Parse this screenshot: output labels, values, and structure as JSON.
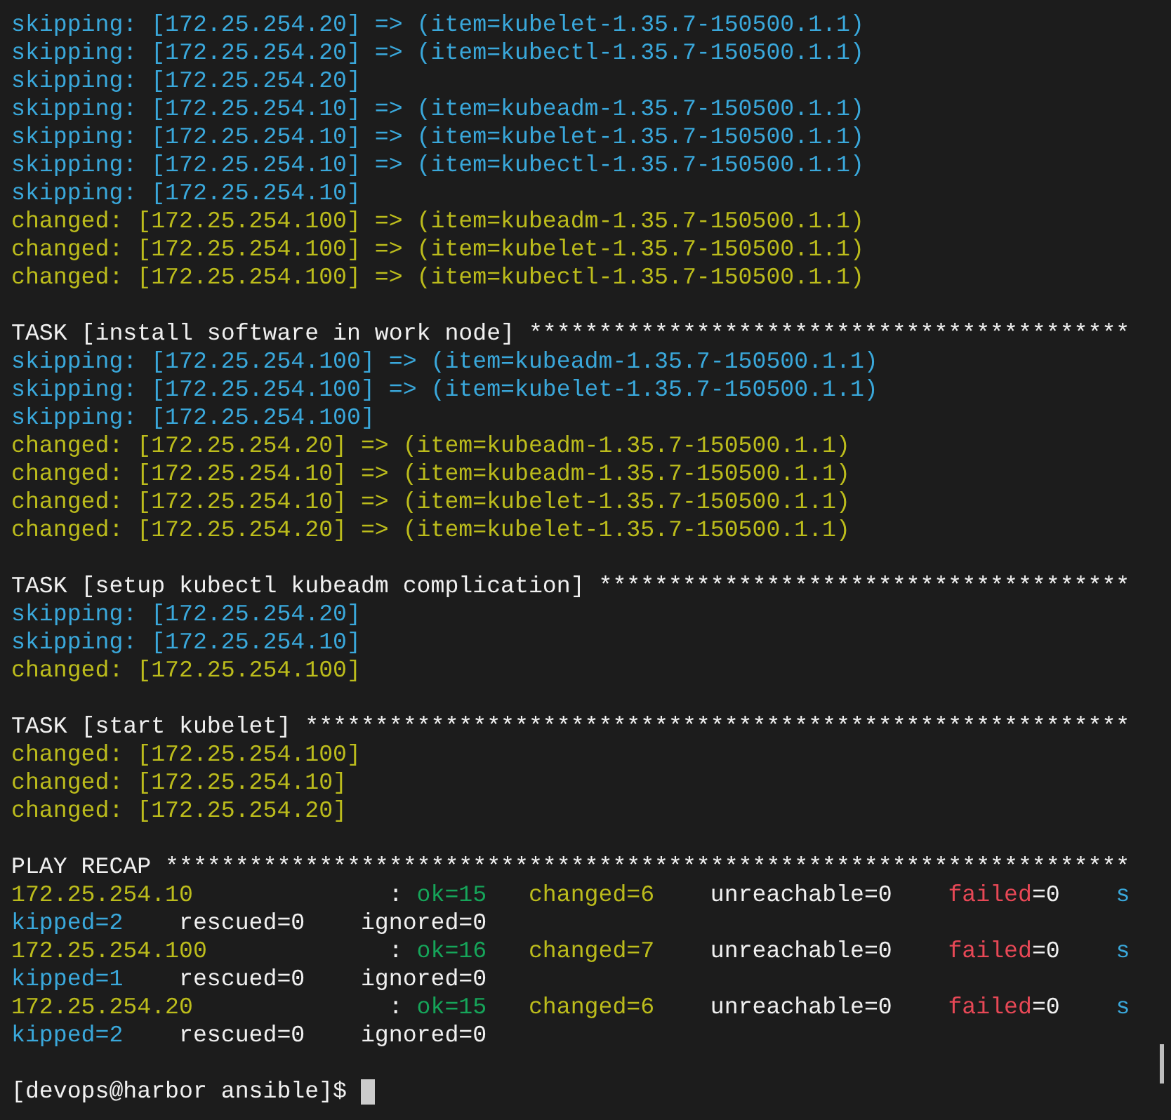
{
  "terminal": {
    "lines": [
      {
        "kind": "text",
        "segments": [
          {
            "text": "skipping: [172.25.254.20] => (item=kubelet-1.35.7-150500.1.1)",
            "color": "#3aa8db"
          }
        ]
      },
      {
        "kind": "text",
        "segments": [
          {
            "text": "skipping: [172.25.254.20] => (item=kubectl-1.35.7-150500.1.1)",
            "color": "#3aa8db"
          }
        ]
      },
      {
        "kind": "text",
        "segments": [
          {
            "text": "skipping: [172.25.254.20]",
            "color": "#3aa8db"
          }
        ]
      },
      {
        "kind": "text",
        "segments": [
          {
            "text": "skipping: [172.25.254.10] => (item=kubeadm-1.35.7-150500.1.1)",
            "color": "#3aa8db"
          }
        ]
      },
      {
        "kind": "text",
        "segments": [
          {
            "text": "skipping: [172.25.254.10] => (item=kubelet-1.35.7-150500.1.1)",
            "color": "#3aa8db"
          }
        ]
      },
      {
        "kind": "text",
        "segments": [
          {
            "text": "skipping: [172.25.254.10] => (item=kubectl-1.35.7-150500.1.1)",
            "color": "#3aa8db"
          }
        ]
      },
      {
        "kind": "text",
        "segments": [
          {
            "text": "skipping: [172.25.254.10]",
            "color": "#3aa8db"
          }
        ]
      },
      {
        "kind": "text",
        "segments": [
          {
            "text": "changed: [172.25.254.100] => (item=kubeadm-1.35.7-150500.1.1)",
            "color": "#bcbc1c"
          }
        ]
      },
      {
        "kind": "text",
        "segments": [
          {
            "text": "changed: [172.25.254.100] => (item=kubelet-1.35.7-150500.1.1)",
            "color": "#bcbc1c"
          }
        ]
      },
      {
        "kind": "text",
        "segments": [
          {
            "text": "changed: [172.25.254.100] => (item=kubectl-1.35.7-150500.1.1)",
            "color": "#bcbc1c"
          }
        ]
      },
      {
        "kind": "blank"
      },
      {
        "kind": "text",
        "segments": [
          {
            "text": "TASK [install software in work node] *******************************************",
            "color": "#f0f0f0"
          }
        ]
      },
      {
        "kind": "text",
        "segments": [
          {
            "text": "skipping: [172.25.254.100] => (item=kubeadm-1.35.7-150500.1.1)",
            "color": "#3aa8db"
          }
        ]
      },
      {
        "kind": "text",
        "segments": [
          {
            "text": "skipping: [172.25.254.100] => (item=kubelet-1.35.7-150500.1.1)",
            "color": "#3aa8db"
          }
        ]
      },
      {
        "kind": "text",
        "segments": [
          {
            "text": "skipping: [172.25.254.100]",
            "color": "#3aa8db"
          }
        ]
      },
      {
        "kind": "text",
        "segments": [
          {
            "text": "changed: [172.25.254.20] => (item=kubeadm-1.35.7-150500.1.1)",
            "color": "#bcbc1c"
          }
        ]
      },
      {
        "kind": "text",
        "segments": [
          {
            "text": "changed: [172.25.254.10] => (item=kubeadm-1.35.7-150500.1.1)",
            "color": "#bcbc1c"
          }
        ]
      },
      {
        "kind": "text",
        "segments": [
          {
            "text": "changed: [172.25.254.10] => (item=kubelet-1.35.7-150500.1.1)",
            "color": "#bcbc1c"
          }
        ]
      },
      {
        "kind": "text",
        "segments": [
          {
            "text": "changed: [172.25.254.20] => (item=kubelet-1.35.7-150500.1.1)",
            "color": "#bcbc1c"
          }
        ]
      },
      {
        "kind": "blank"
      },
      {
        "kind": "text",
        "segments": [
          {
            "text": "TASK [setup kubectl kubeadm complication] **************************************",
            "color": "#f0f0f0"
          }
        ]
      },
      {
        "kind": "text",
        "segments": [
          {
            "text": "skipping: [172.25.254.20]",
            "color": "#3aa8db"
          }
        ]
      },
      {
        "kind": "text",
        "segments": [
          {
            "text": "skipping: [172.25.254.10]",
            "color": "#3aa8db"
          }
        ]
      },
      {
        "kind": "text",
        "segments": [
          {
            "text": "changed: [172.25.254.100]",
            "color": "#bcbc1c"
          }
        ]
      },
      {
        "kind": "blank"
      },
      {
        "kind": "text",
        "segments": [
          {
            "text": "TASK [start kubelet] ***********************************************************",
            "color": "#f0f0f0"
          }
        ]
      },
      {
        "kind": "text",
        "segments": [
          {
            "text": "changed: [172.25.254.100]",
            "color": "#bcbc1c"
          }
        ]
      },
      {
        "kind": "text",
        "segments": [
          {
            "text": "changed: [172.25.254.10]",
            "color": "#bcbc1c"
          }
        ]
      },
      {
        "kind": "text",
        "segments": [
          {
            "text": "changed: [172.25.254.20]",
            "color": "#bcbc1c"
          }
        ]
      },
      {
        "kind": "blank"
      },
      {
        "kind": "text",
        "segments": [
          {
            "text": "PLAY RECAP *********************************************************************",
            "color": "#f0f0f0"
          }
        ]
      },
      {
        "kind": "text",
        "segments": [
          {
            "text": "172.25.254.10",
            "color": "#bcbc1c"
          },
          {
            "text": "              : ",
            "color": "#f0f0f0"
          },
          {
            "text": "ok=15   ",
            "color": "#16a55a"
          },
          {
            "text": "changed=6",
            "color": "#bcbc1c"
          },
          {
            "text": "    unreachable=0    ",
            "color": "#f0f0f0"
          },
          {
            "text": "failed",
            "color": "#e74856"
          },
          {
            "text": "=0    ",
            "color": "#f0f0f0"
          },
          {
            "text": "s",
            "color": "#3aa8db"
          }
        ]
      },
      {
        "kind": "text",
        "segments": [
          {
            "text": "kipped=2",
            "color": "#3aa8db"
          },
          {
            "text": "    rescued=0    ignored=0",
            "color": "#f0f0f0"
          }
        ]
      },
      {
        "kind": "text",
        "segments": [
          {
            "text": "172.25.254.100",
            "color": "#bcbc1c"
          },
          {
            "text": "             : ",
            "color": "#f0f0f0"
          },
          {
            "text": "ok=16   ",
            "color": "#16a55a"
          },
          {
            "text": "changed=7",
            "color": "#bcbc1c"
          },
          {
            "text": "    unreachable=0    ",
            "color": "#f0f0f0"
          },
          {
            "text": "failed",
            "color": "#e74856"
          },
          {
            "text": "=0    ",
            "color": "#f0f0f0"
          },
          {
            "text": "s",
            "color": "#3aa8db"
          }
        ]
      },
      {
        "kind": "text",
        "segments": [
          {
            "text": "kipped=1",
            "color": "#3aa8db"
          },
          {
            "text": "    rescued=0    ignored=0",
            "color": "#f0f0f0"
          }
        ]
      },
      {
        "kind": "text",
        "segments": [
          {
            "text": "172.25.254.20",
            "color": "#bcbc1c"
          },
          {
            "text": "              : ",
            "color": "#f0f0f0"
          },
          {
            "text": "ok=15   ",
            "color": "#16a55a"
          },
          {
            "text": "changed=6",
            "color": "#bcbc1c"
          },
          {
            "text": "    unreachable=0    ",
            "color": "#f0f0f0"
          },
          {
            "text": "failed",
            "color": "#e74856"
          },
          {
            "text": "=0    ",
            "color": "#f0f0f0"
          },
          {
            "text": "s",
            "color": "#3aa8db"
          }
        ]
      },
      {
        "kind": "text",
        "segments": [
          {
            "text": "kipped=2",
            "color": "#3aa8db"
          },
          {
            "text": "    rescued=0    ignored=0",
            "color": "#f0f0f0"
          }
        ]
      },
      {
        "kind": "blank"
      },
      {
        "kind": "prompt",
        "segments": [
          {
            "text": "[devops@harbor ansible]$ ",
            "color": "#f0f0f0"
          }
        ]
      }
    ]
  }
}
